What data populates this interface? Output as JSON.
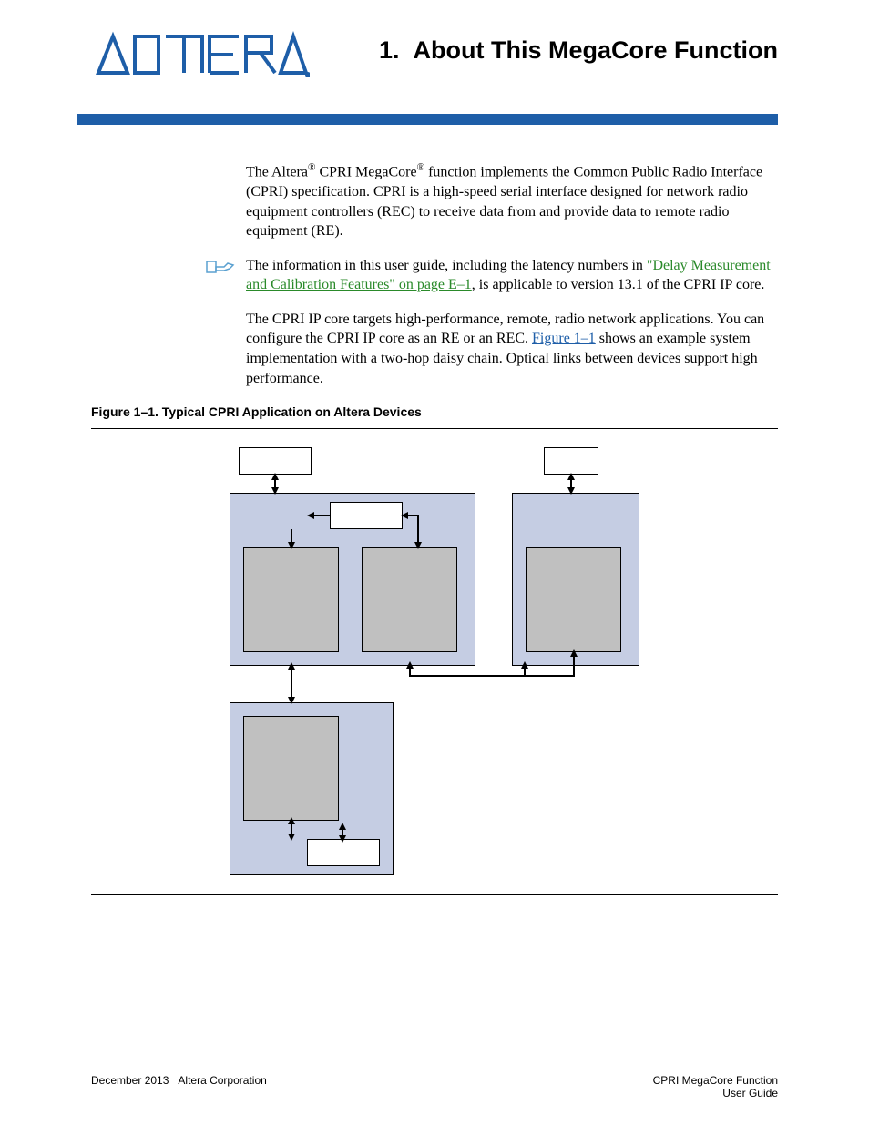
{
  "header": {
    "logo_alt": "Altera",
    "chapter_number": "1.",
    "chapter_title": "About This MegaCore Function"
  },
  "paragraphs": {
    "p1_pre": "The Altera",
    "p1_mid": " CPRI MegaCore",
    "p1_post": " function implements the Common Public Radio Interface (CPRI) specification. CPRI is a high-speed serial interface designed for network radio equipment controllers (REC) to receive data from and provide data to remote radio equipment (RE).",
    "note_pre": "The information in this user guide, including the latency numbers in ",
    "note_link": "\"Delay Measurement and Calibration Features\" on page E–1",
    "note_post": ", is applicable to version 13.1 of the CPRI IP core.",
    "p3_pre": "The CPRI IP core targets high-performance, remote, radio network applications. You can configure the CPRI IP core as an RE or an REC. ",
    "p3_link": "Figure 1–1",
    "p3_post": " shows an example system implementation with a two-hop daisy chain. Optical links between devices support high performance."
  },
  "figure": {
    "caption": "Figure 1–1. Typical CPRI Application on Altera Devices"
  },
  "footer": {
    "left_date": "December 2013",
    "left_company": "Altera Corporation",
    "right_line1": "CPRI MegaCore Function",
    "right_line2": "User Guide"
  }
}
